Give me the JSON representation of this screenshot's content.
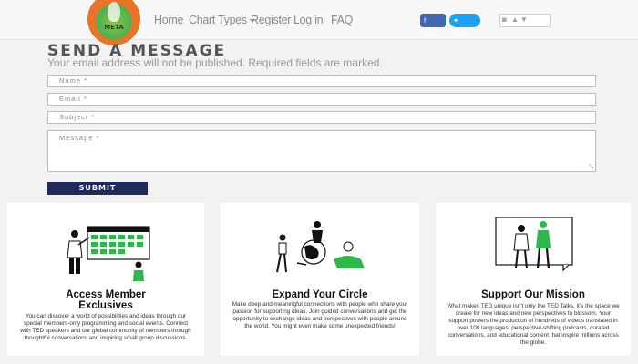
{
  "navbar": {
    "logo_text": "META",
    "links": {
      "home": "Home",
      "chart_types": "Chart Types",
      "register": "Register",
      "login": "Log in",
      "faq": "FAQ"
    },
    "share": {
      "facebook": "Share",
      "twitter": "Tweet"
    }
  },
  "form": {
    "title": "SEND A MESSAGE",
    "subtitle": "Your email address will not be published. Required fields are marked.",
    "fields": {
      "name": "Name *",
      "email": "Email *",
      "subject": "Subject *",
      "message": "Message *"
    },
    "submit": "SUBMIT"
  },
  "cards": [
    {
      "title_line1": "Access Member",
      "title_line2": "Exclusives",
      "text": "You can discover a world of possibilities and ideas through our special members-only programming and social events. Connect with TED speakers and our global community of members through thoughtful conversations and inspiring small group discussions.",
      "icon": "calendar-people-icon"
    },
    {
      "title": "Expand Your Circle",
      "text": "Make deep and meaningful connections with people who share your passion for supporting ideas. Join guided conversations and get the opportunity to exchange ideas and perspectives with people around the world. You might even make some unexpected friends!",
      "icon": "globe-people-icon"
    },
    {
      "title": "Support Our Mission",
      "text": "What makes TED unique isn't only the TED Talks, it's the space we create for new ideas and new perspectives to blossom. Your support powers the production of hundreds of videos translated in over 100 languages, perspective-shifting podcasts, curated conversations, and educational content that inspire millions across the globe.",
      "icon": "people-frame-icon"
    }
  ],
  "colors": {
    "accent_green": "#2db84b",
    "submit_navy": "#1d2a5a",
    "facebook": "#4267b2",
    "twitter": "#1da1f2"
  }
}
